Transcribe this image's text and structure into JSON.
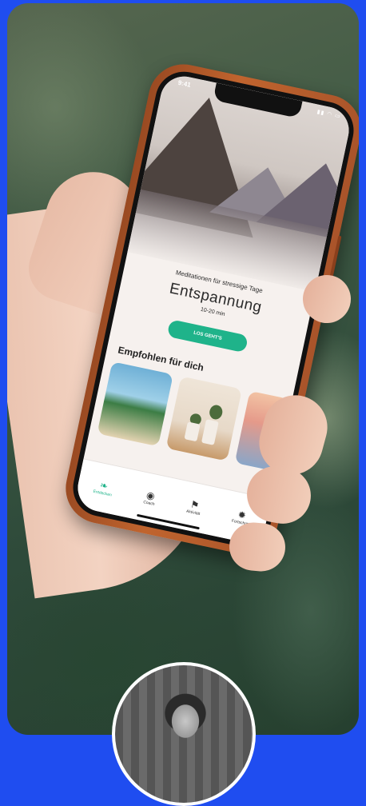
{
  "phone_screen": {
    "status_time": "9:41",
    "status_icons": "▮▮ ◠ ▭",
    "hero": {
      "subtitle": "Meditationen für stressige Tage",
      "title": "Entspannung",
      "duration": "10-20 min",
      "cta_label": "LOS GEHT'S"
    },
    "section_title": "Empfohlen für dich",
    "tabs": [
      {
        "label": "Entdecken",
        "icon": "leaf-icon",
        "glyph": "❧",
        "active": true
      },
      {
        "label": "Coach",
        "icon": "coach-icon",
        "glyph": "◉",
        "active": false
      },
      {
        "label": "Aktivität",
        "icon": "flag-icon",
        "glyph": "⚑",
        "active": false
      },
      {
        "label": "Fortschritt",
        "icon": "gear-icon",
        "glyph": "✹",
        "active": false
      }
    ]
  },
  "colors": {
    "background": "#1f4df0",
    "phone_case": "#b95b2a",
    "accent": "#1fb38a"
  }
}
